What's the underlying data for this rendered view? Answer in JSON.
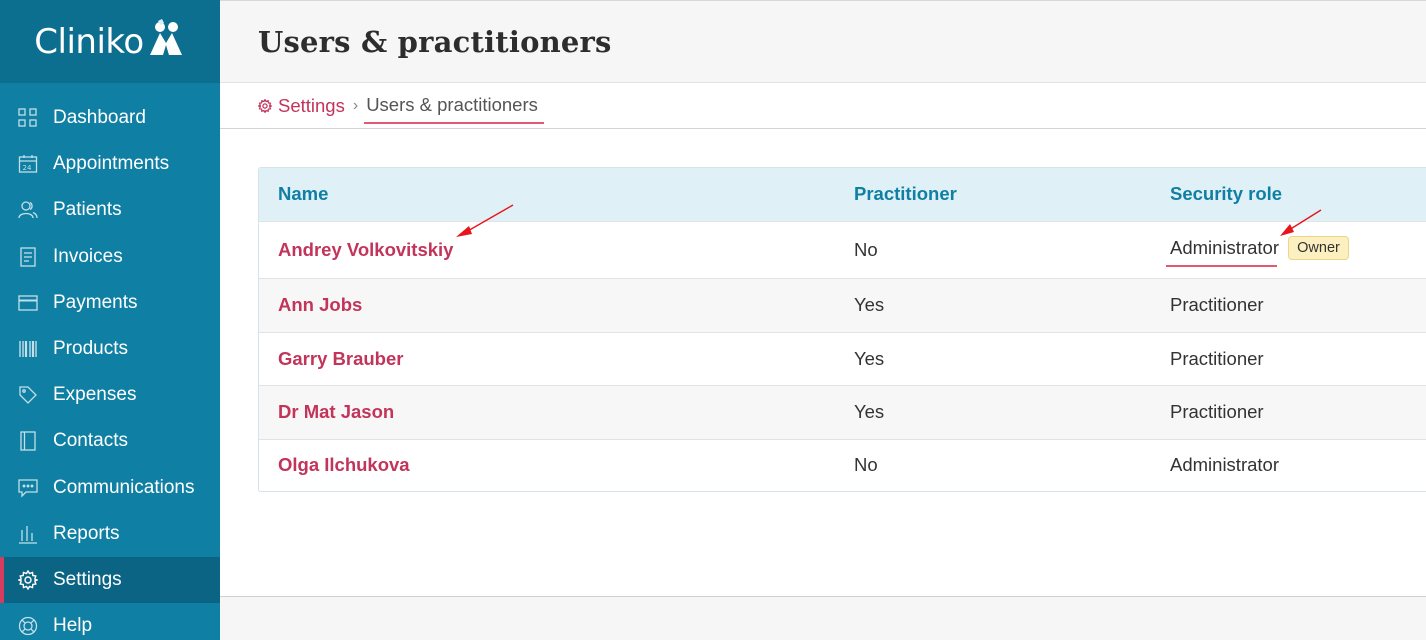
{
  "app": {
    "logo_text": "Cliniko"
  },
  "sidebar": {
    "items": [
      {
        "label": "Dashboard",
        "icon": "grid-icon"
      },
      {
        "label": "Appointments",
        "icon": "calendar-icon"
      },
      {
        "label": "Patients",
        "icon": "people-icon"
      },
      {
        "label": "Invoices",
        "icon": "document-icon"
      },
      {
        "label": "Payments",
        "icon": "card-icon"
      },
      {
        "label": "Products",
        "icon": "barcode-icon"
      },
      {
        "label": "Expenses",
        "icon": "tag-icon"
      },
      {
        "label": "Contacts",
        "icon": "book-icon"
      },
      {
        "label": "Communications",
        "icon": "chat-icon"
      },
      {
        "label": "Reports",
        "icon": "bar-chart-icon"
      },
      {
        "label": "Settings",
        "icon": "gear-icon",
        "active": true
      },
      {
        "label": "Help",
        "icon": "lifebuoy-icon"
      }
    ]
  },
  "header": {
    "title": "Users & practitioners"
  },
  "breadcrumb": {
    "parent": "Settings",
    "current": "Users & practitioners"
  },
  "table": {
    "columns": [
      "Name",
      "Practitioner",
      "Security role"
    ],
    "rows": [
      {
        "name": "Andrey Volkovitskiy",
        "practitioner": "No",
        "role": "Administrator",
        "badge": "Owner"
      },
      {
        "name": "Ann Jobs",
        "practitioner": "Yes",
        "role": "Practitioner"
      },
      {
        "name": "Garry Brauber",
        "practitioner": "Yes",
        "role": "Practitioner"
      },
      {
        "name": "Dr Mat Jason",
        "practitioner": "Yes",
        "role": "Practitioner"
      },
      {
        "name": "Olga Ilchukova",
        "practitioner": "No",
        "role": "Administrator"
      }
    ]
  },
  "colors": {
    "sidebar": "#0f7fa3",
    "sidebar_active": "#0c6484",
    "accent": "#c2345a",
    "table_header": "#dff0f6",
    "annotation_arrow": "#e8141c"
  }
}
